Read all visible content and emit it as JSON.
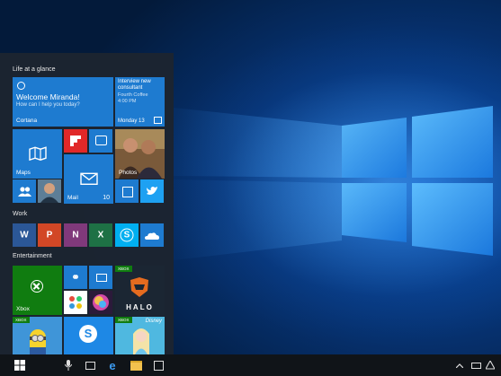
{
  "start_menu": {
    "groups": {
      "life_at_a_glance": "Life at a glance",
      "work": "Work",
      "entertainment": "Entertainment"
    },
    "cortana_tile": {
      "title": "Welcome Miranda!",
      "subtitle": "How can I help you today?",
      "label": "Cortana"
    },
    "calendar_tile": {
      "event": "Interview new consultant",
      "location": "Fourth Coffee",
      "time": "4:00 PM",
      "date": "Monday 13"
    },
    "maps_tile": {
      "label": "Maps"
    },
    "photos_tile": {
      "label": "Photos"
    },
    "mail_tile": {
      "label": "Mail",
      "count": "10"
    },
    "xbox_tile": {
      "label": "Xbox"
    },
    "xbox_badges": [
      "XBOX",
      "XBOX",
      "XBOX"
    ],
    "halo_tile": {
      "text": "HALO"
    },
    "disney_tile": {
      "text": "Disney"
    }
  },
  "colors": {
    "accent": "#1e7bd0",
    "start_bg": "#1c2430",
    "taskbar_bg": "#101418",
    "xbox_green": "#107c10",
    "flipboard_red": "#e12828",
    "word_blue": "#2b5797",
    "ppt_orange": "#d24726",
    "onenote_purple": "#80397b",
    "excel_green": "#1e7145",
    "skype_blue": "#00aff0"
  }
}
